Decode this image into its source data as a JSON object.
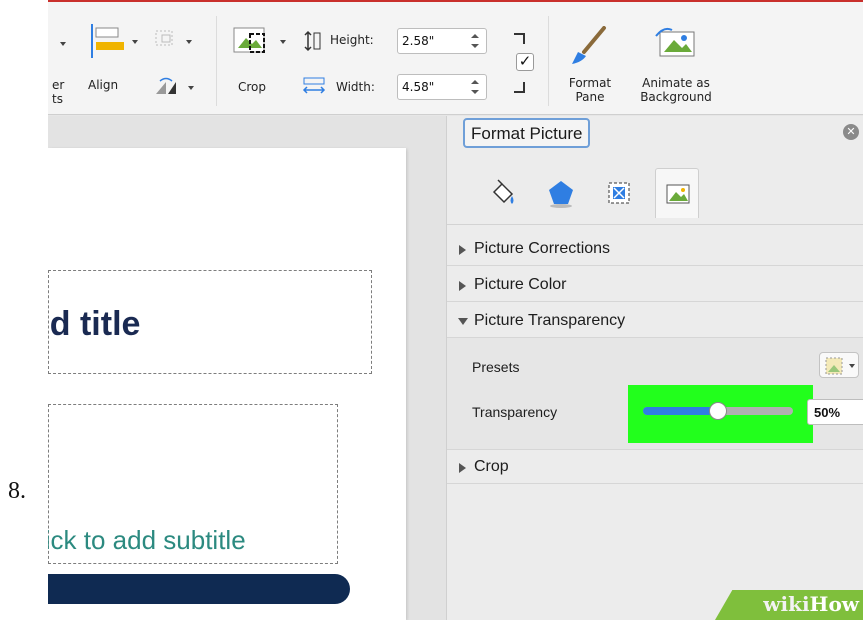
{
  "step_number": "8.",
  "ribbon": {
    "partial_label_line1": "er",
    "partial_label_line2": "ts",
    "align_label": "Align",
    "crop_label": "Crop",
    "height_label": "Height:",
    "height_value": "2.58\"",
    "width_label": "Width:",
    "width_value": "4.58\"",
    "format_pane_line1": "Format",
    "format_pane_line2": "Pane",
    "animate_line1": "Animate as",
    "animate_line2": "Background",
    "lock_aspect_checked": true
  },
  "slide": {
    "title_placeholder": "dd title",
    "subtitle_placeholder": "lick to add subtitle",
    "colors": {
      "title": "#1a2a52",
      "subtitle": "#2c8a80",
      "bar": "#0f2a52"
    }
  },
  "pane": {
    "title": "Format Picture",
    "tabs": [
      {
        "icon": "fill-bucket-icon"
      },
      {
        "icon": "pentagon-effects-icon"
      },
      {
        "icon": "size-properties-icon"
      },
      {
        "icon": "picture-icon",
        "active": true
      }
    ],
    "sections": [
      {
        "label": "Picture Corrections",
        "expanded": false
      },
      {
        "label": "Picture Color",
        "expanded": false
      },
      {
        "label": "Picture Transparency",
        "expanded": true
      },
      {
        "label": "Crop",
        "expanded": false
      }
    ],
    "transparency": {
      "presets_label": "Presets",
      "transparency_label": "Transparency",
      "value_text": "50%",
      "value_fraction": 0.5
    },
    "highlight_color": "#22ff1c",
    "accent_color": "#2f7ee2"
  },
  "watermark": {
    "part1": "wiki",
    "part2": "How"
  }
}
